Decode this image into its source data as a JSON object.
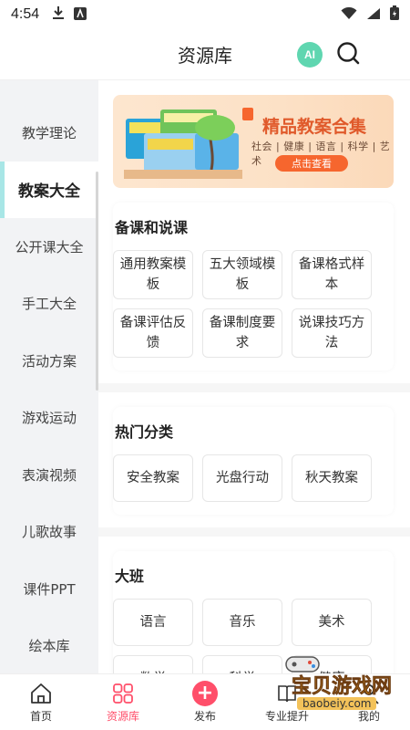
{
  "status_bar": {
    "time": "4:54",
    "icons_left": [
      "download-icon",
      "app-icon"
    ],
    "icons_right": [
      "wifi-icon",
      "signal-icon",
      "battery-icon"
    ]
  },
  "header": {
    "title": "资源库",
    "ai_label": "AI",
    "ai_color": "#5fd6b0"
  },
  "sidebar": {
    "items": [
      {
        "label": "教学理论",
        "active": false
      },
      {
        "label": "教案大全",
        "active": true
      },
      {
        "label": "公开课大全",
        "active": false
      },
      {
        "label": "手工大全",
        "active": false
      },
      {
        "label": "活动方案",
        "active": false
      },
      {
        "label": "游戏运动",
        "active": false
      },
      {
        "label": "表演视频",
        "active": false
      },
      {
        "label": "儿歌故事",
        "active": false
      },
      {
        "label": "课件PPT",
        "active": false
      },
      {
        "label": "绘本库",
        "active": false
      }
    ],
    "accent_color": "#a8e6e6"
  },
  "banner": {
    "title": "精品教案合集",
    "subtitle": "社会 | 健康 | 语言 | 科学 | 艺术",
    "button_label": "点击查看"
  },
  "sections": [
    {
      "title": "备课和说课",
      "items": [
        "通用教案模板",
        "五大领域模板",
        "备课格式样本",
        "备课评估反馈",
        "备课制度要求",
        "说课技巧方法"
      ]
    },
    {
      "title": "热门分类",
      "items": [
        "安全教案",
        "光盘行动",
        "秋天教案"
      ]
    },
    {
      "title": "大班",
      "items": [
        "语言",
        "音乐",
        "美术",
        "数学",
        "科学",
        "健康"
      ]
    }
  ],
  "bottom_nav": {
    "items": [
      {
        "label": "首页",
        "icon": "home-icon",
        "active": false
      },
      {
        "label": "资源库",
        "icon": "grid-icon",
        "active": true
      },
      {
        "label": "发布",
        "icon": "plus-icon",
        "active": false
      },
      {
        "label": "专业提升",
        "icon": "book-icon",
        "active": false
      },
      {
        "label": "我的",
        "icon": "profile-icon",
        "active": false
      }
    ],
    "active_color": "#ff4f6a"
  },
  "watermark": {
    "text": "宝贝游戏网",
    "url": "baobeiy.com"
  }
}
